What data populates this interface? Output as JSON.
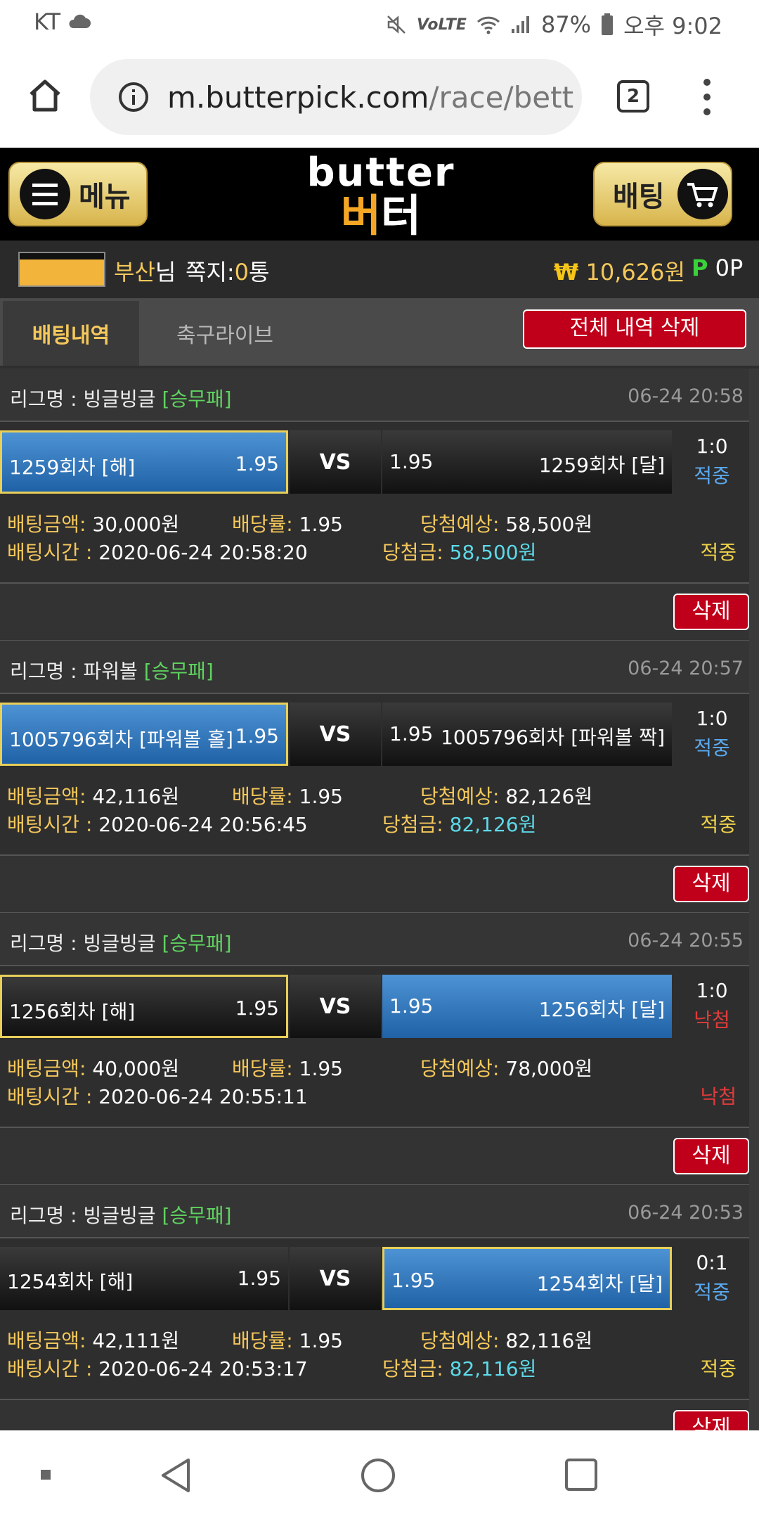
{
  "status": {
    "carrier": "KT",
    "battery": "87%",
    "time": "오후 9:02",
    "lte": "VoLTE"
  },
  "browser": {
    "url_host": "m.butterpick.com",
    "url_path": "/race/bett",
    "tab_count": "2"
  },
  "site": {
    "menu_label": "메뉴",
    "bet_label": "배팅",
    "logo_en": "butter",
    "logo_ko_a": "버",
    "logo_ko_b": "터"
  },
  "user": {
    "name": "부산",
    "name_suffix": "님",
    "msg_label": "쪽지:",
    "msg_count": "0",
    "msg_unit": "통",
    "currency_symbol": "₩",
    "balance": "10,626원",
    "point_symbol": "P",
    "points": "0P"
  },
  "tabs": {
    "bet_history": "배팅내역",
    "soccer_live": "축구라이브",
    "delete_all": "전체 내역 삭제"
  },
  "labels": {
    "league_prefix": "리그명 : ",
    "vs": "VS",
    "bet_amount": "배팅금액:",
    "odds": "배당률:",
    "expected": "당첨예상:",
    "bet_time": "배팅시간 : ",
    "won_amount": "당첨금:",
    "delete": "삭제"
  },
  "bets": [
    {
      "league": "빙글빙글",
      "type": "[승무패]",
      "datetime": "06-24 20:58",
      "home": "1259회차 [해]",
      "home_odds": "1.95",
      "away_odds": "1.95",
      "away": "1259회차 [달]",
      "picked": "home",
      "score": "1:0",
      "result": "적중",
      "amount": "30,000원",
      "odds": "1.95",
      "expected": "58,500원",
      "time": "2020-06-24 20:58:20",
      "winnings": "58,500원",
      "status": "적중"
    },
    {
      "league": "파워볼",
      "type": "[승무패]",
      "datetime": "06-24 20:57",
      "home": "1005796회차 [파워볼 홀]",
      "home_odds": "1.95",
      "away_odds": "1.95",
      "away": "1005796회차 [파워볼 짝]",
      "picked": "home",
      "score": "1:0",
      "result": "적중",
      "amount": "42,116원",
      "odds": "1.95",
      "expected": "82,126원",
      "time": "2020-06-24 20:56:45",
      "winnings": "82,126원",
      "status": "적중"
    },
    {
      "league": "빙글빙글",
      "type": "[승무패]",
      "datetime": "06-24 20:55",
      "home": "1256회차 [해]",
      "home_odds": "1.95",
      "away_odds": "1.95",
      "away": "1256회차 [달]",
      "picked": "home",
      "score": "1:0",
      "result": "낙첨",
      "amount": "40,000원",
      "odds": "1.95",
      "expected": "78,000원",
      "time": "2020-06-24 20:55:11",
      "winnings": "",
      "status": "낙첨"
    },
    {
      "league": "빙글빙글",
      "type": "[승무패]",
      "datetime": "06-24 20:53",
      "home": "1254회차 [해]",
      "home_odds": "1.95",
      "away_odds": "1.95",
      "away": "1254회차 [달]",
      "picked": "away",
      "score": "0:1",
      "result": "적중",
      "amount": "42,111원",
      "odds": "1.95",
      "expected": "82,116원",
      "time": "2020-06-24 20:53:17",
      "winnings": "82,116원",
      "status": "적중"
    }
  ],
  "colors": {
    "accent_gold": "#f5c85b",
    "win_blue": "#5aa9f0",
    "lose_red": "#e03a3a",
    "status_yellow": "#f0d24a",
    "delete_red": "#c0001a"
  }
}
